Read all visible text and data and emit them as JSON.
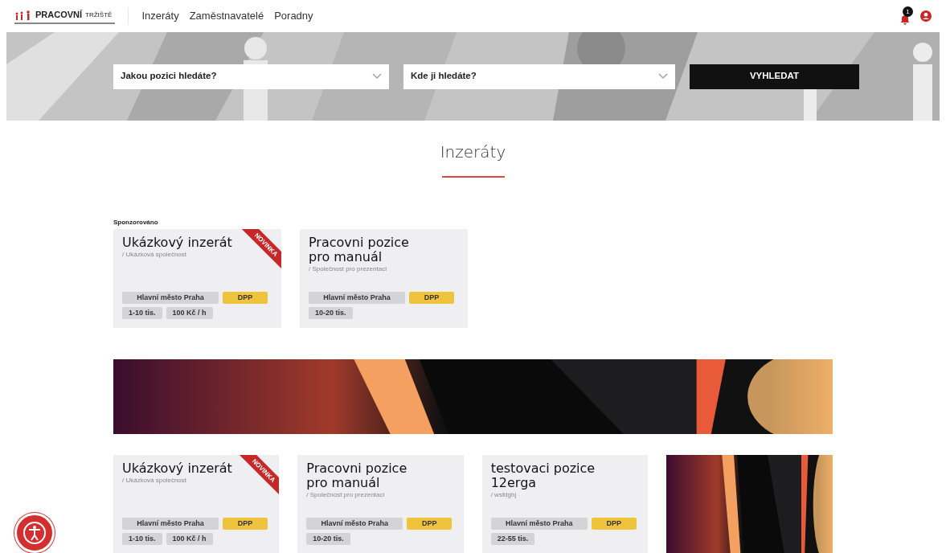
{
  "logo": {
    "text": "PRACOVNÍ",
    "subtext": "TRŽIŠTĚ"
  },
  "nav": [
    {
      "label": "Inzeráty"
    },
    {
      "label": "Zaměstnavatelé"
    },
    {
      "label": "Poradny"
    }
  ],
  "notifications": {
    "count": "1"
  },
  "search": {
    "position_placeholder": "Jakou pozici hledáte?",
    "location_placeholder": "Kde ji hledáte?",
    "button": "VYHLEDAT"
  },
  "heading": "Inzeráty",
  "sponsored": {
    "label": "Sponzorováno",
    "cards": [
      {
        "title": "Ukázkový inzerát",
        "company": "/ Ukázková společnost",
        "badge": "NOVINKA",
        "tags": [
          {
            "kind": "location",
            "text": "Hlavní město Praha"
          },
          {
            "kind": "contract",
            "text": "DPP"
          },
          {
            "kind": "salary",
            "text": "1-10 tis."
          },
          {
            "kind": "salary",
            "text": "100 Kč / h"
          }
        ]
      },
      {
        "title": "Pracovni pozice pro manuál",
        "company": "/ Společnost pro prezentaci",
        "tags": [
          {
            "kind": "location",
            "text": "Hlavní město Praha"
          },
          {
            "kind": "contract",
            "text": "DPP"
          },
          {
            "kind": "salary",
            "text": "10-20 tis."
          }
        ]
      }
    ]
  },
  "cards": [
    {
      "kind": "listing",
      "title": "Ukázkový inzerát",
      "company": "/ Ukázková společnost",
      "badge": "NOVINKA",
      "tags": [
        {
          "kind": "location",
          "text": "Hlavní město Praha"
        },
        {
          "kind": "contract",
          "text": "DPP"
        },
        {
          "kind": "salary",
          "text": "1-10 tis."
        },
        {
          "kind": "salary",
          "text": "100 Kč / h"
        }
      ]
    },
    {
      "kind": "listing",
      "title": "Pracovni pozice pro manuál",
      "company": "/ Společnost pro prezentaci",
      "tags": [
        {
          "kind": "location",
          "text": "Hlavní město Praha"
        },
        {
          "kind": "contract",
          "text": "DPP"
        },
        {
          "kind": "salary",
          "text": "10-20 tis."
        }
      ]
    },
    {
      "kind": "listing",
      "title": "testovaci pozice 12erga",
      "company": "/ wsfdghj",
      "tags": [
        {
          "kind": "location",
          "text": "Hlavní město Praha"
        },
        {
          "kind": "contract",
          "text": "DPP"
        },
        {
          "kind": "salary",
          "text": "22-55 tis."
        }
      ]
    },
    {
      "kind": "picture"
    }
  ]
}
